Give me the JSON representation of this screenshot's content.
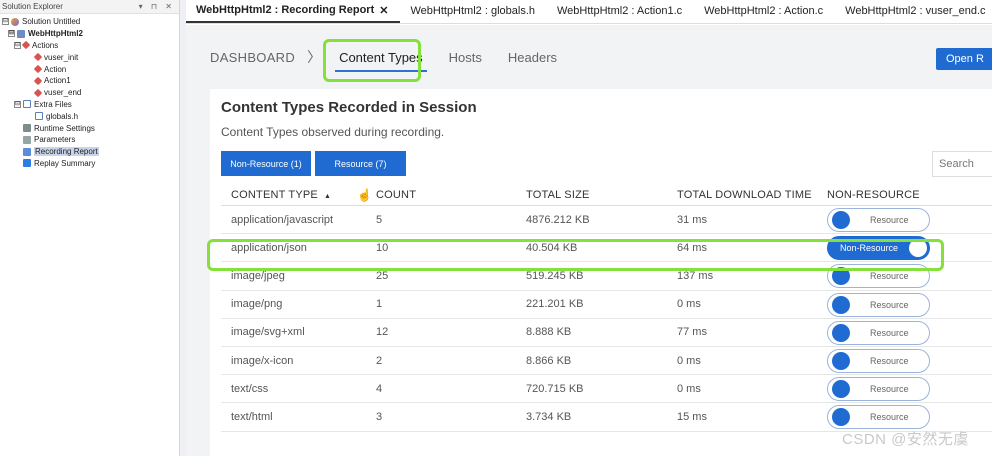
{
  "explorer": {
    "title": "Solution Explorer",
    "controls": "▾ ⊓ ✕",
    "nodes": [
      {
        "label": "Solution Untitled",
        "toggle": "⊟",
        "icon": "solution-icon",
        "indent": 0
      },
      {
        "label": "WebHttpHtml2",
        "toggle": "⊟",
        "icon": "project-icon",
        "indent": 1,
        "bold": true
      },
      {
        "label": "Actions",
        "toggle": "⊟",
        "icon": "actions-icon",
        "indent": 2
      },
      {
        "label": "vuser_init",
        "toggle": "",
        "icon": "action-icon",
        "indent": 4
      },
      {
        "label": "Action",
        "toggle": "",
        "icon": "action-icon",
        "indent": 4
      },
      {
        "label": "Action1",
        "toggle": "",
        "icon": "action-icon",
        "indent": 4
      },
      {
        "label": "vuser_end",
        "toggle": "",
        "icon": "action-icon",
        "indent": 4
      },
      {
        "label": "Extra Files",
        "toggle": "⊟",
        "icon": "folder-icon",
        "indent": 2
      },
      {
        "label": "globals.h",
        "toggle": "",
        "icon": "file-icon",
        "indent": 4
      },
      {
        "label": "Runtime Settings",
        "toggle": "",
        "icon": "runtime-settings-icon",
        "indent": 2
      },
      {
        "label": "Parameters",
        "toggle": "",
        "icon": "parameters-icon",
        "indent": 2
      },
      {
        "label": "Recording Report",
        "toggle": "",
        "icon": "report-icon",
        "indent": 2,
        "selected": true
      },
      {
        "label": "Replay Summary",
        "toggle": "",
        "icon": "replay-icon",
        "indent": 2
      }
    ]
  },
  "tabs": [
    {
      "label": "WebHttpHtml2 : Recording Report",
      "active": true,
      "close": "✕"
    },
    {
      "label": "WebHttpHtml2 : globals.h"
    },
    {
      "label": "WebHttpHtml2 : Action1.c"
    },
    {
      "label": "WebHttpHtml2 : Action.c"
    },
    {
      "label": "WebHttpHtml2 : vuser_end.c"
    }
  ],
  "nav": {
    "dashboard": "DASHBOARD",
    "chevron": "〉",
    "tabs": [
      "Content Types",
      "Hosts",
      "Headers"
    ],
    "active_tab": "Content Types",
    "open_button": "Open R"
  },
  "card": {
    "title": "Content Types Recorded in Session",
    "subtitle": "Content Types observed during recording.",
    "filter_non_resource": "Non-Resource (1)",
    "filter_resource": "Resource (7)",
    "search_placeholder": "Search"
  },
  "table": {
    "headers": [
      "CONTENT TYPE",
      "COUNT",
      "TOTAL SIZE",
      "TOTAL DOWNLOAD TIME",
      "NON-RESOURCE"
    ],
    "sort_indicator": "▲",
    "rows": [
      {
        "type": "application/javascript",
        "count": "5",
        "size": "4876.212 KB",
        "time": "31 ms",
        "toggle": "Resource",
        "on": false
      },
      {
        "type": "application/json",
        "count": "10",
        "size": "40.504 KB",
        "time": "64 ms",
        "toggle": "Non-Resource",
        "on": true
      },
      {
        "type": "image/jpeg",
        "count": "25",
        "size": "519.245 KB",
        "time": "137 ms",
        "toggle": "Resource",
        "on": false
      },
      {
        "type": "image/png",
        "count": "1",
        "size": "221.201 KB",
        "time": "0 ms",
        "toggle": "Resource",
        "on": false
      },
      {
        "type": "image/svg+xml",
        "count": "12",
        "size": "8.888 KB",
        "time": "77 ms",
        "toggle": "Resource",
        "on": false
      },
      {
        "type": "image/x-icon",
        "count": "2",
        "size": "8.866 KB",
        "time": "0 ms",
        "toggle": "Resource",
        "on": false
      },
      {
        "type": "text/css",
        "count": "4",
        "size": "720.715 KB",
        "time": "0 ms",
        "toggle": "Resource",
        "on": false
      },
      {
        "type": "text/html",
        "count": "3",
        "size": "3.734 KB",
        "time": "15 ms",
        "toggle": "Resource",
        "on": false
      }
    ]
  },
  "watermark": "CSDN @安然无虞",
  "colors": {
    "accent": "#1f6bd2",
    "highlight": "#84e03a"
  }
}
